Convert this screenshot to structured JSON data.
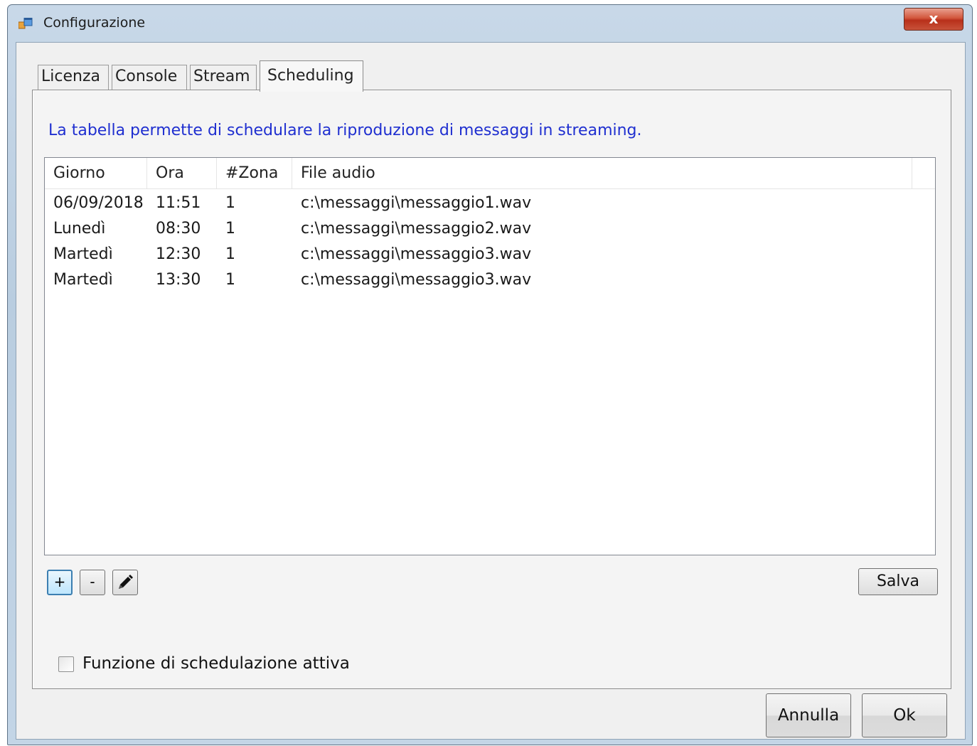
{
  "window": {
    "title": "Configurazione",
    "close_glyph": "x"
  },
  "tabs": [
    {
      "label": "Licenza"
    },
    {
      "label": "Console"
    },
    {
      "label": "Stream"
    },
    {
      "label": "Scheduling",
      "active": true
    }
  ],
  "scheduling": {
    "description": "La tabella permette di schedulare la riproduzione di messaggi in streaming.",
    "columns": [
      "Giorno",
      "Ora",
      "#Zona",
      "File audio"
    ],
    "rows": [
      {
        "giorno": "06/09/2018",
        "ora": "11:51",
        "zona": "1",
        "file": "c:\\messaggi\\messaggio1.wav"
      },
      {
        "giorno": "Lunedì",
        "ora": "08:30",
        "zona": "1",
        "file": "c:\\messaggi\\messaggio2.wav"
      },
      {
        "giorno": "Martedì",
        "ora": "12:30",
        "zona": "1",
        "file": "c:\\messaggi\\messaggio3.wav"
      },
      {
        "giorno": "Martedì",
        "ora": "13:30",
        "zona": "1",
        "file": "c:\\messaggi\\messaggio3.wav"
      }
    ],
    "add_label": "+",
    "remove_label": "-",
    "edit_icon": "pencil-icon",
    "save_label": "Salva",
    "checkbox_label": "Funzione di schedulazione attiva",
    "checkbox_checked": false
  },
  "footer": {
    "cancel_label": "Annulla",
    "ok_label": "Ok"
  },
  "colors": {
    "description_text": "#1f2fd0",
    "close_button": "#c8452c",
    "focus_border": "#3c7fb1"
  }
}
